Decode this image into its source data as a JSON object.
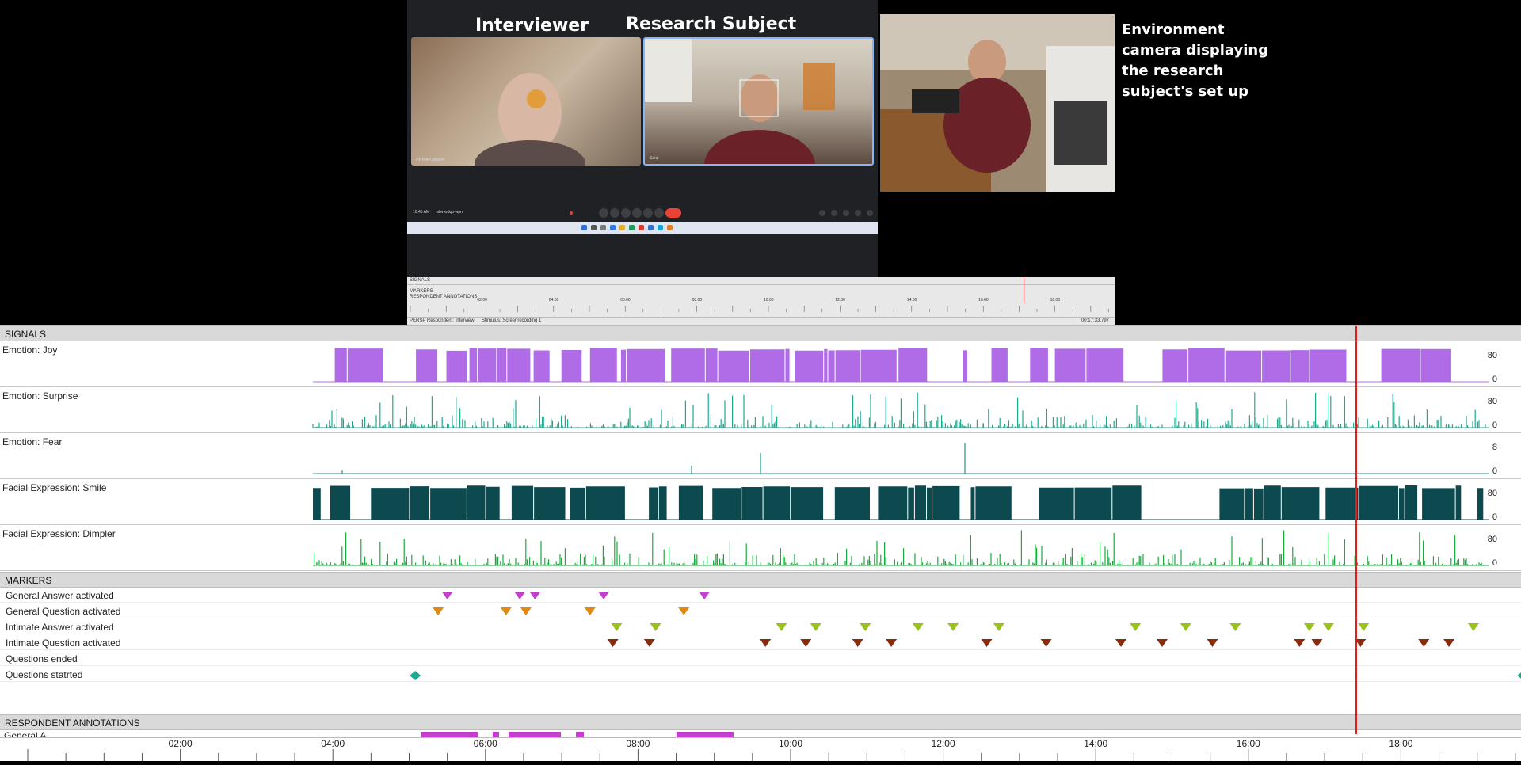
{
  "call": {
    "interviewer_label": "Interviewer",
    "subject_label": "Research Subject",
    "interviewer_name": "Pernille Ottesen",
    "subject_name": "Sara",
    "clock": "10:45 AM",
    "meeting_code": "mbv-wdqp-wpn"
  },
  "environment_caption": "Environment camera displaying the research subject's set up",
  "mini_timeline": {
    "signals": "SIGNALS",
    "markers": "MARKERS",
    "annotations": "RESPONDENT ANNOTATIONS",
    "ticks": [
      "02:00",
      "04:00",
      "06:00",
      "08:00",
      "10:00",
      "12:00",
      "14:00",
      "16:00",
      "18:00"
    ],
    "footer_left": "PERSP Respondent: Interview",
    "footer_mid": "Stimulus: Screenrecording 1",
    "footer_right": "00:17:33.797"
  },
  "sections": {
    "signals": "SIGNALS",
    "markers": "MARKERS",
    "annotations": "RESPONDENT ANNOTATIONS"
  },
  "signals": [
    {
      "label": "Emotion: Joy",
      "max": "80",
      "min": "0",
      "color": "#b06ce6",
      "kind": "block"
    },
    {
      "label": "Emotion: Surprise",
      "max": "80",
      "min": "0",
      "color": "#1aab8f",
      "kind": "spike"
    },
    {
      "label": "Emotion: Fear",
      "max": "8",
      "min": "0",
      "color": "#1a9a85",
      "kind": "flat"
    },
    {
      "label": "Facial Expression: Smile",
      "max": "80",
      "min": "0",
      "color": "#0d4a4f",
      "kind": "block"
    },
    {
      "label": "Facial Expression: Dimpler",
      "max": "80",
      "min": "0",
      "color": "#1aaa3e",
      "kind": "spike"
    }
  ],
  "markers": [
    {
      "label": "General Answer activated",
      "color": "#c43fce",
      "shape": "down",
      "times": [
        5.5,
        6.45,
        6.65,
        7.55,
        8.87
      ]
    },
    {
      "label": "General Question activated",
      "color": "#e08a13",
      "shape": "down",
      "times": [
        5.38,
        6.27,
        6.53,
        7.37,
        8.6
      ]
    },
    {
      "label": "Intimate Answer activated",
      "color": "#9ac21d",
      "shape": "down",
      "times": [
        7.72,
        8.23,
        9.88,
        10.33,
        10.98,
        11.67,
        12.13,
        12.73,
        14.52,
        15.18,
        15.83,
        16.8,
        17.05,
        17.51,
        18.95
      ]
    },
    {
      "label": "Intimate Question activated",
      "color": "#8b2a0d",
      "shape": "down",
      "times": [
        7.67,
        8.15,
        9.67,
        10.2,
        10.88,
        11.32,
        12.57,
        13.35,
        14.33,
        14.87,
        15.53,
        16.67,
        16.9,
        17.47,
        18.3,
        18.63
      ]
    },
    {
      "label": "Questions ended",
      "color": "#1aa891",
      "shape": "diamond",
      "times": []
    },
    {
      "label": "Questions statrted",
      "color": "#1aa891",
      "shape": "diamond",
      "times": [
        5.08,
        19.6
      ]
    }
  ],
  "annotation_partial_label": "General A",
  "axis": {
    "ticks": [
      "02:00",
      "04:00",
      "06:00",
      "08:00",
      "10:00",
      "12:00",
      "14:00",
      "16:00",
      "18:00"
    ],
    "tick_minutes": [
      2,
      4,
      6,
      8,
      10,
      12,
      14,
      16,
      18
    ]
  },
  "playhead_minute": 17.4
}
